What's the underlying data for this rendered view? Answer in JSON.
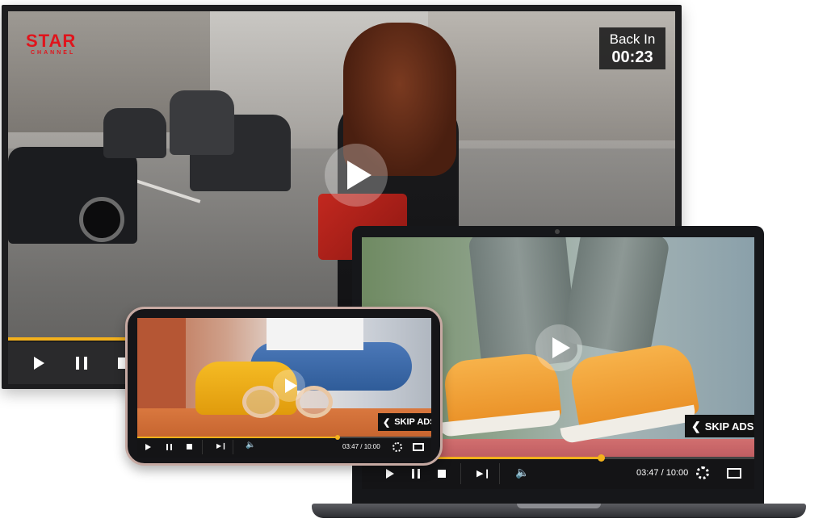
{
  "tv": {
    "logo_text": "STAR",
    "logo_sub": "CHANNEL",
    "back_in_label": "Back In",
    "back_in_time": "00:23",
    "progress": 1.0
  },
  "laptop": {
    "skip_label": "SKIP ADS",
    "time": "03:47 / 10:00",
    "progress": 0.61
  },
  "phone": {
    "skip_label": "SKIP ADS",
    "time": "03:47 / 10:00",
    "progress": 0.68
  },
  "icons": {
    "play": "play-icon",
    "pause": "pause-icon",
    "stop": "stop-icon",
    "next": "next-icon",
    "volume": "volume-icon",
    "settings": "gear-icon",
    "fullscreen": "fullscreen-icon",
    "chevron": "chevron-left-icon"
  },
  "colors": {
    "accent": "#f3b11c",
    "logo": "#e0141c"
  }
}
